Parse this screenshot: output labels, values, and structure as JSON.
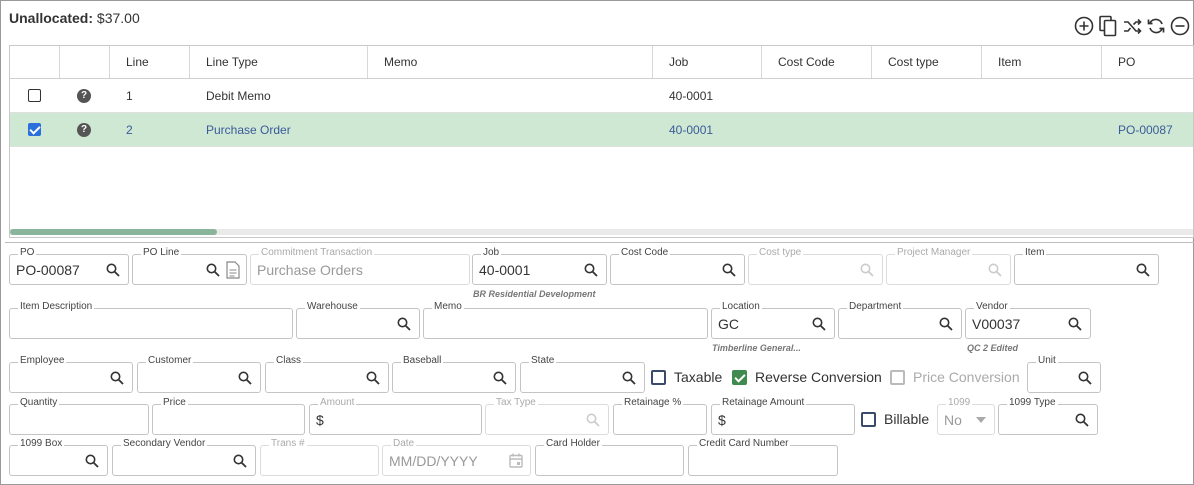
{
  "header": {
    "unallocated_label": "Unallocated:",
    "unallocated_value": "$37.00"
  },
  "toolbar": {
    "icons": [
      "add-circle-icon",
      "copy-icon",
      "split-icon",
      "refresh-icon",
      "remove-circle-icon"
    ]
  },
  "grid": {
    "columns": [
      "",
      "",
      "Line",
      "Line Type",
      "Memo",
      "Job",
      "Cost Code",
      "Cost type",
      "Item",
      "PO"
    ],
    "rows": [
      {
        "checked": false,
        "line": "1",
        "line_type": "Debit Memo",
        "memo": "",
        "job": "40-0001",
        "cost_code": "",
        "cost_type": "",
        "item": "",
        "po": ""
      },
      {
        "checked": true,
        "line": "2",
        "line_type": "Purchase Order",
        "memo": "",
        "job": "40-0001",
        "cost_code": "",
        "cost_type": "",
        "item": "",
        "po": "PO-00087"
      }
    ],
    "help_glyph": "?"
  },
  "form": {
    "po": {
      "label": "PO",
      "value": "PO-00087"
    },
    "po_line": {
      "label": "PO Line",
      "value": ""
    },
    "commitment_transaction": {
      "label": "Commitment Transaction",
      "placeholder": "Purchase Orders"
    },
    "job": {
      "label": "Job",
      "value": "40-0001",
      "hint": "BR Residential Development"
    },
    "cost_code": {
      "label": "Cost Code",
      "value": ""
    },
    "cost_type": {
      "label": "Cost type",
      "value": ""
    },
    "project_manager": {
      "label": "Project Manager",
      "value": ""
    },
    "item": {
      "label": "Item",
      "value": ""
    },
    "item_description": {
      "label": "Item Description",
      "value": ""
    },
    "warehouse": {
      "label": "Warehouse",
      "value": ""
    },
    "memo": {
      "label": "Memo",
      "value": ""
    },
    "location": {
      "label": "Location",
      "value": "GC",
      "hint": "Timberline General..."
    },
    "department": {
      "label": "Department",
      "value": ""
    },
    "vendor": {
      "label": "Vendor",
      "value": "V00037",
      "hint": "QC 2 Edited"
    },
    "employee": {
      "label": "Employee",
      "value": ""
    },
    "customer": {
      "label": "Customer",
      "value": ""
    },
    "class": {
      "label": "Class",
      "value": ""
    },
    "baseball": {
      "label": "Baseball",
      "value": ""
    },
    "state": {
      "label": "State",
      "value": ""
    },
    "taxable": {
      "label": "Taxable",
      "checked": false
    },
    "reverse_conversion": {
      "label": "Reverse Conversion",
      "checked": true
    },
    "price_conversion": {
      "label": "Price Conversion",
      "checked": false
    },
    "unit": {
      "label": "Unit",
      "value": ""
    },
    "quantity": {
      "label": "Quantity",
      "value": ""
    },
    "price": {
      "label": "Price",
      "value": ""
    },
    "amount": {
      "label": "Amount",
      "value": "$"
    },
    "tax_type": {
      "label": "Tax Type",
      "value": ""
    },
    "retainage_pct": {
      "label": "Retainage %",
      "value": ""
    },
    "retainage_amount": {
      "label": "Retainage Amount",
      "value": "$"
    },
    "billable": {
      "label": "Billable",
      "checked": false
    },
    "f1099": {
      "label": "1099",
      "value": "No"
    },
    "f1099_type": {
      "label": "1099 Type",
      "value": ""
    },
    "f1099_box": {
      "label": "1099 Box",
      "value": ""
    },
    "secondary_vendor": {
      "label": "Secondary Vendor",
      "value": ""
    },
    "trans_no": {
      "label": "Trans #",
      "value": ""
    },
    "date": {
      "label": "Date",
      "placeholder": "MM/DD/YYYY"
    },
    "card_holder": {
      "label": "Card Holder",
      "value": ""
    },
    "credit_card_number": {
      "label": "Credit Card Number",
      "value": ""
    }
  }
}
